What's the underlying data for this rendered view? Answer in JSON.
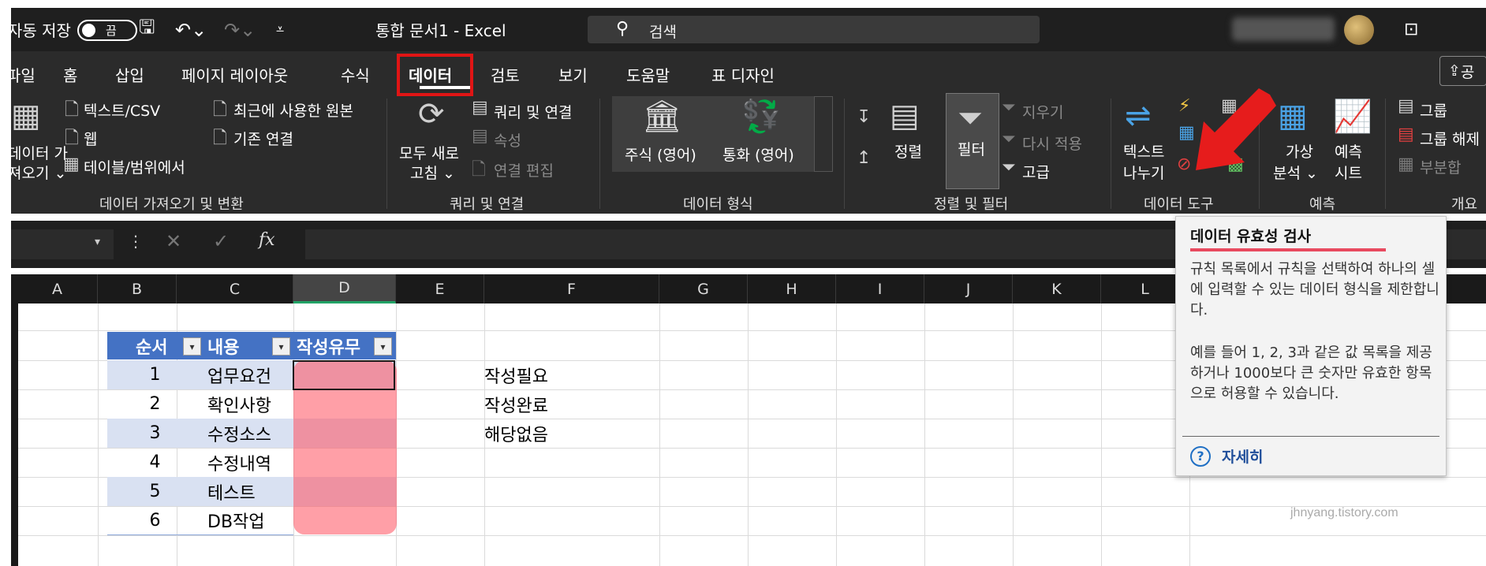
{
  "titlebar": {
    "autosave_label": "자동 저장",
    "autosave_state": "끔",
    "doc_title": "통합 문서1  -  Excel",
    "search_placeholder": "검색"
  },
  "tabs": [
    {
      "label": "파일"
    },
    {
      "label": "홈"
    },
    {
      "label": "삽입"
    },
    {
      "label": "페이지 레이아웃"
    },
    {
      "label": "수식"
    },
    {
      "label": "데이터"
    },
    {
      "label": "검토"
    },
    {
      "label": "보기"
    },
    {
      "label": "도움말"
    },
    {
      "label": "표 디자인"
    }
  ],
  "share_label": "공",
  "ribbon": {
    "get_data": {
      "line1": "데이터 가",
      "line2": "져오기 ⌄"
    },
    "text_csv": "텍스트/CSV",
    "web": "웹",
    "table_range": "테이블/범위에서",
    "recent_sources": "최근에 사용한 원본",
    "existing_conn": "기존 연결",
    "group_get": "데이터 가져오기 및 변환",
    "refresh_all": {
      "line1": "모두 새로",
      "line2": "고침 ⌄"
    },
    "queries_conn": "쿼리 및 연결",
    "properties": "속성",
    "edit_links": "연결 편집",
    "group_queries": "쿼리 및 연결",
    "stocks": "주식 (영어)",
    "currency": "통화 (영어)",
    "group_types": "데이터 형식",
    "sort": "정렬",
    "filter": "필터",
    "clear": "지우기",
    "reapply": "다시 적용",
    "advanced": "고급",
    "group_sort": "정렬 및 필터",
    "text_to_col": {
      "line1": "텍스트",
      "line2": "나누기"
    },
    "group_tools": "데이터 도구",
    "whatif": {
      "line1": "가상",
      "line2": "분석 ⌄"
    },
    "forecast": {
      "line1": "예측",
      "line2": "시트"
    },
    "group_forecast": "예측",
    "group_btn": "그룹",
    "ungroup_btn": "그룹 해제",
    "subtotal_btn": "부분합",
    "group_outline": "개요"
  },
  "formula_bar": {
    "fx": "fx"
  },
  "columns": [
    "A",
    "B",
    "C",
    "D",
    "E",
    "F",
    "G",
    "H",
    "I",
    "J",
    "K",
    "L"
  ],
  "table": {
    "headers": [
      "순서",
      "내용",
      "작성유무"
    ],
    "rows": [
      {
        "num": "1",
        "content": "업무요건"
      },
      {
        "num": "2",
        "content": "확인사항"
      },
      {
        "num": "3",
        "content": "수정소스"
      },
      {
        "num": "4",
        "content": "수정내역"
      },
      {
        "num": "5",
        "content": "테스트"
      },
      {
        "num": "6",
        "content": "DB작업"
      }
    ]
  },
  "list_values": [
    "작성필요",
    "작성완료",
    "해당없음"
  ],
  "tooltip": {
    "title": "데이터 유효성 검사",
    "p1": "규칙 목록에서 규칙을 선택하여 하나의 셀에 입력할 수 있는 데이터 형식을 제한합니다.",
    "p2": "예를 들어 1, 2, 3과 같은 값 목록을 제공하거나 1000보다 큰 숫자만 유효한 항목으로 허용할 수 있습니다.",
    "help": "자세히"
  },
  "watermark": "jhnyang.tistory.com",
  "colors": {
    "accent_red": "#e01515",
    "table_header": "#4472c4",
    "band": "#d9e1f2",
    "highlight": "#ff5060"
  }
}
